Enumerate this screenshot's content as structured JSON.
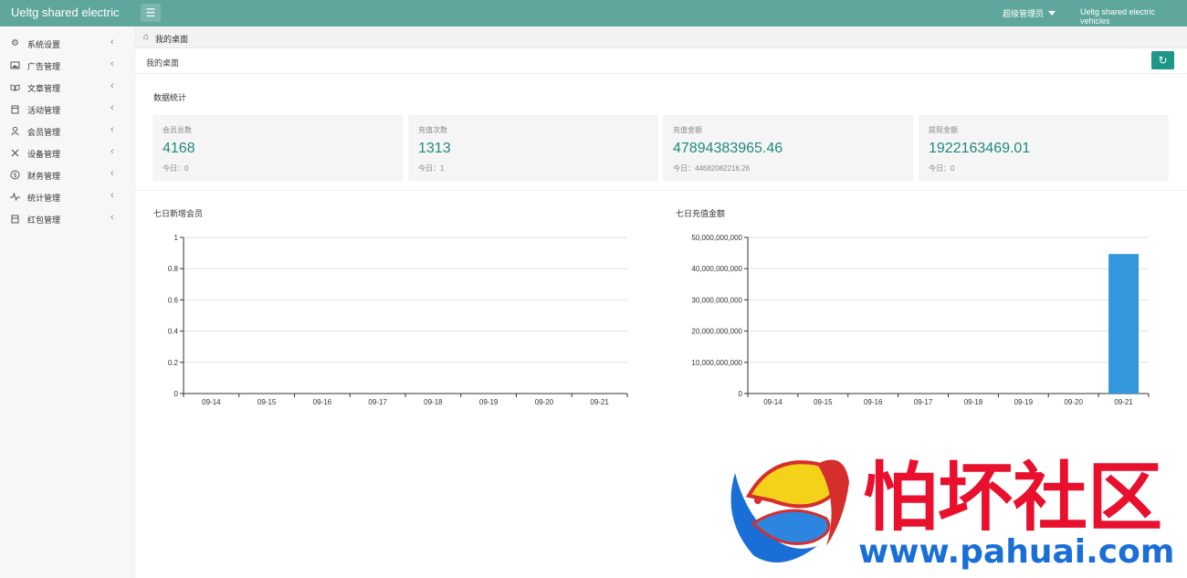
{
  "header": {
    "brand": "Ueltg shared electric",
    "user": "超级管理员",
    "site": "Ueltg shared electric vehicles"
  },
  "sidebar": {
    "items": [
      {
        "label": "系统设置",
        "icon": "gear-icon"
      },
      {
        "label": "广告管理",
        "icon": "image-icon"
      },
      {
        "label": "文章管理",
        "icon": "book-icon"
      },
      {
        "label": "活动管理",
        "icon": "calendar-icon"
      },
      {
        "label": "会员管理",
        "icon": "user-icon"
      },
      {
        "label": "设备管理",
        "icon": "tools-icon"
      },
      {
        "label": "财务管理",
        "icon": "dollar-icon"
      },
      {
        "label": "统计管理",
        "icon": "pulse-icon"
      },
      {
        "label": "红包管理",
        "icon": "gift-icon"
      }
    ]
  },
  "breadcrumb": {
    "label": "我的桌面"
  },
  "page": {
    "subtitle": "我的桌面",
    "section_title": "数据统计"
  },
  "stats": [
    {
      "label": "会员总数",
      "value": "4168",
      "today": "今日：0"
    },
    {
      "label": "充值次数",
      "value": "1313",
      "today": "今日：1"
    },
    {
      "label": "充值金额",
      "value": "47894383965.46",
      "today": "今日：44682082216.26"
    },
    {
      "label": "提现金额",
      "value": "1922163469.01",
      "today": "今日：0"
    }
  ],
  "colors": {
    "header": "#5fa79d",
    "accent": "#1e8a7e",
    "bar": "#3398db"
  },
  "chart_data": [
    {
      "type": "bar",
      "title": "七日新增会员",
      "categories": [
        "09-14",
        "09-15",
        "09-16",
        "09-17",
        "09-18",
        "09-19",
        "09-20",
        "09-21"
      ],
      "values": [
        0,
        0,
        0,
        0,
        0,
        0,
        0,
        0
      ],
      "ylim": [
        0,
        1
      ],
      "yticks": [
        "0",
        "0.2",
        "0.4",
        "0.6",
        "0.8",
        "1"
      ],
      "grid": true
    },
    {
      "type": "bar",
      "title": "七日充值金额",
      "categories": [
        "09-14",
        "09-15",
        "09-16",
        "09-17",
        "09-18",
        "09-19",
        "09-20",
        "09-21"
      ],
      "values": [
        0,
        0,
        0,
        0,
        0,
        0,
        0,
        44682082216.26
      ],
      "ylim": [
        0,
        50000000000
      ],
      "yticks": [
        "0",
        "10,000,000,000",
        "20,000,000,000",
        "30,000,000,000",
        "40,000,000,000",
        "50,000,000,000"
      ],
      "grid": true
    }
  ],
  "watermark": {
    "text": "怕坏社区",
    "url": "www.pahuai.com"
  }
}
